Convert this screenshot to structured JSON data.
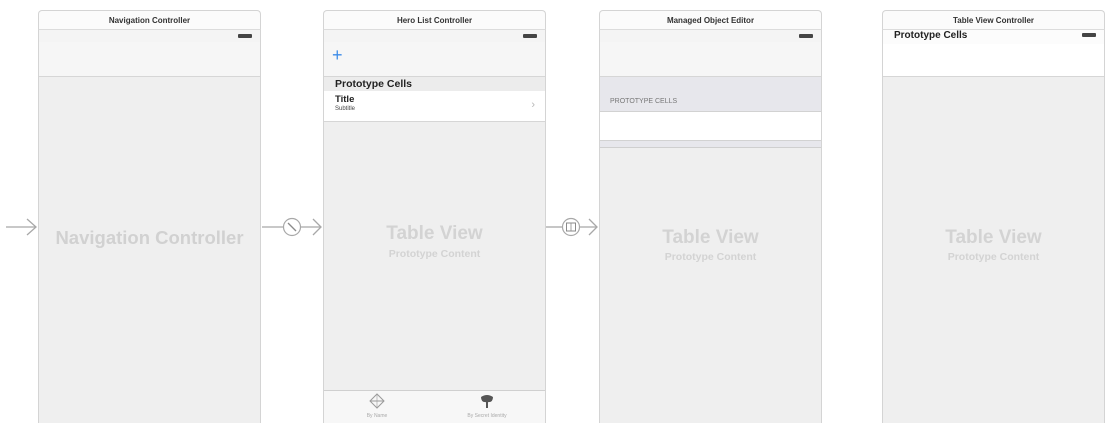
{
  "scenes": {
    "navigation": {
      "title": "Navigation Controller",
      "placeholder": "Navigation Controller"
    },
    "hero_list": {
      "title": "Hero List Controller",
      "add_symbol": "+",
      "section_header": "Prototype Cells",
      "cell": {
        "title": "Title",
        "subtitle": "Subtitle",
        "chevron": "›"
      },
      "placeholder_title": "Table View",
      "placeholder_subtitle": "Prototype Content",
      "tabs": [
        {
          "label": "By Name",
          "icon": "compass-icon"
        },
        {
          "label": "By Secret Identity",
          "icon": "mask-icon"
        }
      ]
    },
    "object_editor": {
      "title": "Managed Object Editor",
      "section_header": "PROTOTYPE CELLS",
      "placeholder_title": "Table View",
      "placeholder_subtitle": "Prototype Content"
    },
    "table_view": {
      "title": "Table View Controller",
      "section_header": "Prototype Cells",
      "placeholder_title": "Table View",
      "placeholder_subtitle": "Prototype Content"
    }
  },
  "colors": {
    "accent": "#3d8ce8",
    "placeholder": "#d3d3d3",
    "segue": "#a8a8a8"
  },
  "segues": [
    {
      "kind": "entry-point"
    },
    {
      "kind": "root-view-controller",
      "icon": "relationship-icon"
    },
    {
      "kind": "show",
      "icon": "show-segue-icon"
    }
  ]
}
